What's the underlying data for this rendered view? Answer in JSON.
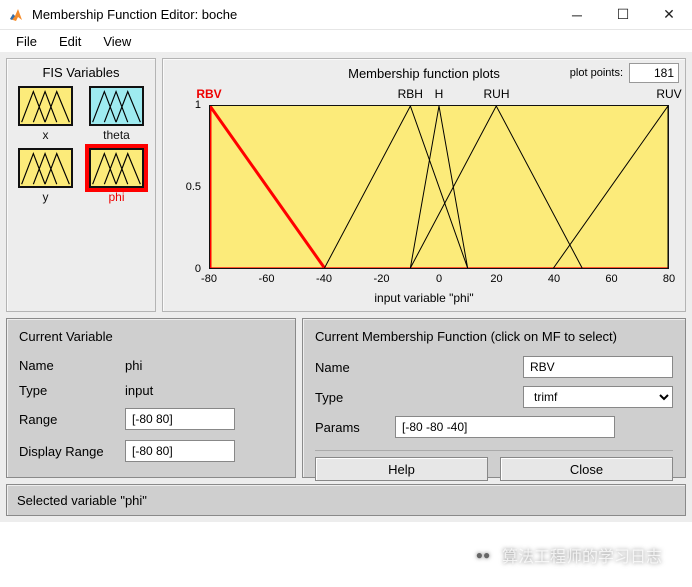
{
  "window": {
    "title": "Membership Function Editor: boche"
  },
  "menu": {
    "file": "File",
    "edit": "Edit",
    "view": "View"
  },
  "fis": {
    "title": "FIS Variables",
    "vars": [
      {
        "name": "x",
        "kind": "input",
        "selected": false
      },
      {
        "name": "theta",
        "kind": "output",
        "selected": false
      },
      {
        "name": "y",
        "kind": "input",
        "selected": false
      },
      {
        "name": "phi",
        "kind": "input",
        "selected": true
      }
    ]
  },
  "plot": {
    "title": "Membership function plots",
    "plot_points_label": "plot points:",
    "plot_points": "181",
    "x_axis_label": "input variable \"phi\"",
    "mf_names": [
      "RBV",
      "RBH",
      "H",
      "RUH",
      "RUV"
    ],
    "selected_mf_index": 0,
    "y_ticks": [
      "0",
      "0.5",
      "1"
    ],
    "x_ticks": [
      "-80",
      "-60",
      "-40",
      "-20",
      "0",
      "20",
      "40",
      "60",
      "80"
    ]
  },
  "cv": {
    "title": "Current Variable",
    "name_label": "Name",
    "name": "phi",
    "type_label": "Type",
    "type": "input",
    "range_label": "Range",
    "range": "[-80 80]",
    "disp_label": "Display Range",
    "disp": "[-80 80]"
  },
  "cmf": {
    "title": "Current Membership Function (click on MF to select)",
    "name_label": "Name",
    "name": "RBV",
    "type_label": "Type",
    "type": "trimf",
    "params_label": "Params",
    "params": "[-80 -80 -40]",
    "help_btn": "Help",
    "close_btn": "Close"
  },
  "status": "Selected variable \"phi\"",
  "watermark": "算法工程师的学习日志",
  "chart_data": {
    "type": "line",
    "title": "Membership function plots",
    "xlabel": "input variable \"phi\"",
    "ylabel": "",
    "xlim": [
      -80,
      80
    ],
    "ylim": [
      0,
      1
    ],
    "x_ticks": [
      -80,
      -60,
      -40,
      -20,
      0,
      20,
      40,
      60,
      80
    ],
    "y_ticks": [
      0,
      0.5,
      1
    ],
    "series": [
      {
        "name": "RBV",
        "type": "trimf",
        "params": [
          -80,
          -80,
          -40
        ],
        "color": "#ff0000",
        "linewidth": 3
      },
      {
        "name": "RBH",
        "type": "trimf",
        "params": [
          -40,
          -10,
          10
        ],
        "color": "#000000",
        "linewidth": 1
      },
      {
        "name": "H",
        "type": "trimf",
        "params": [
          -10,
          0,
          10
        ],
        "color": "#000000",
        "linewidth": 1
      },
      {
        "name": "RUH",
        "type": "trimf",
        "params": [
          -10,
          20,
          50
        ],
        "color": "#000000",
        "linewidth": 1
      },
      {
        "name": "RUV",
        "type": "trimf",
        "params": [
          40,
          80,
          80
        ],
        "color": "#000000",
        "linewidth": 1
      }
    ]
  }
}
